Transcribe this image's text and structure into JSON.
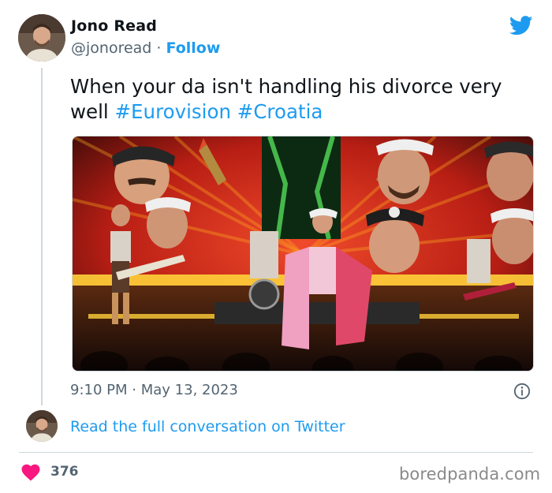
{
  "author": {
    "name": "Jono Read",
    "handle": "@jonoread",
    "separator": "·",
    "follow_label": "Follow"
  },
  "tweet": {
    "text_main": "When your da isn't handling his divorce very well",
    "hashtags": [
      "#Eurovision",
      "#Croatia"
    ],
    "timestamp_time": "9:10 PM",
    "timestamp_separator": "·",
    "timestamp_date": "May 13, 2023"
  },
  "footer": {
    "read_link": "Read the full conversation on Twitter",
    "likes": "376"
  },
  "watermark": "boredpanda.com",
  "colors": {
    "link": "#1d9bf0",
    "heart": "#f91880",
    "text_primary": "#0f1419",
    "text_secondary": "#536471"
  },
  "icons": {
    "brand": "twitter-bird-icon",
    "info": "info-circle-icon",
    "like": "heart-icon"
  }
}
